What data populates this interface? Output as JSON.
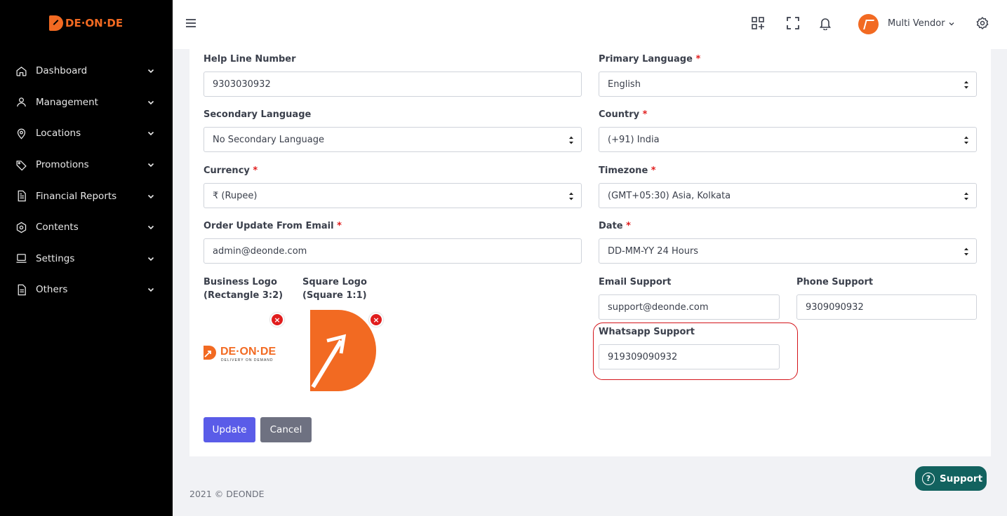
{
  "brand": {
    "name": "DE·ON·DE"
  },
  "sidebar": {
    "items": [
      {
        "label": "Dashboard",
        "icon": "home-icon"
      },
      {
        "label": "Management",
        "icon": "user-icon"
      },
      {
        "label": "Locations",
        "icon": "map-pin-icon"
      },
      {
        "label": "Promotions",
        "icon": "tag-icon"
      },
      {
        "label": "Financial Reports",
        "icon": "document-icon"
      },
      {
        "label": "Contents",
        "icon": "gear-icon"
      },
      {
        "label": "Settings",
        "icon": "laptop-icon"
      },
      {
        "label": "Others",
        "icon": "file-icon"
      }
    ]
  },
  "topbar": {
    "user": "Multi Vendor"
  },
  "form": {
    "help_line_label": "Help Line Number",
    "help_line_value": "9303030932",
    "primary_language_label": "Primary Language",
    "primary_language_value": "English",
    "secondary_language_label": "Secondary Language",
    "secondary_language_value": "No Secondary Language",
    "country_label": "Country",
    "country_value": "(+91) India",
    "currency_label": "Currency",
    "currency_value": "₹ (Rupee)",
    "timezone_label": "Timezone",
    "timezone_value": "(GMT+05:30) Asia, Kolkata",
    "order_email_label": "Order Update From Email",
    "order_email_value": "admin@deonde.com",
    "date_label": "Date",
    "date_value": "DD-MM-YY 24 Hours",
    "business_logo_label_1": "Business Logo",
    "business_logo_label_2": "(Rectangle 3:2)",
    "square_logo_label_1": "Square Logo",
    "square_logo_label_2": "(Square 1:1)",
    "email_support_label": "Email Support",
    "email_support_value": "support@deonde.com",
    "phone_support_label": "Phone Support",
    "phone_support_value": "9309090932",
    "whatsapp_label": "Whatsapp Support",
    "whatsapp_value": "919309090932",
    "required_mark": "*",
    "remove_mark": "×"
  },
  "logo_rect": {
    "name": "DE·ON·DE",
    "tagline": "DELIVERY ON DEMAND"
  },
  "buttons": {
    "update": "Update",
    "cancel": "Cancel"
  },
  "footer": {
    "text": "2021 © DEONDE"
  },
  "support": {
    "label": "Support",
    "icon_glyph": "?"
  },
  "colors": {
    "accent": "#f26a22",
    "primary": "#5a5ce8",
    "support": "#12625f",
    "highlight": "#d4141a"
  }
}
